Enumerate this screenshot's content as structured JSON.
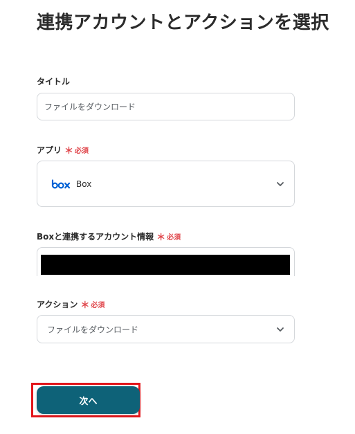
{
  "page": {
    "title": "連携アカウントとアクションを選択"
  },
  "form": {
    "title_field": {
      "label": "タイトル",
      "value": "ファイルをダウンロード"
    },
    "app_field": {
      "label": "アプリ",
      "required_mark": "＊",
      "required_text": "必須",
      "selected_app": "Box",
      "app_icon": "box-logo-icon",
      "dropdown_icon": "chevron-down-icon"
    },
    "account_field": {
      "label": "Boxと連携するアカウント情報",
      "required_mark": "＊",
      "required_text": "必須"
    },
    "action_field": {
      "label": "アクション",
      "required_mark": "＊",
      "required_text": "必須",
      "selected_action": "ファイルをダウンロード",
      "dropdown_icon": "chevron-down-icon"
    }
  },
  "next_button": {
    "label": "次へ"
  },
  "colors": {
    "primary_button": "#0e6278",
    "required": "#e0464b",
    "highlight": "#e3161b",
    "box_brand": "#0061d5"
  }
}
